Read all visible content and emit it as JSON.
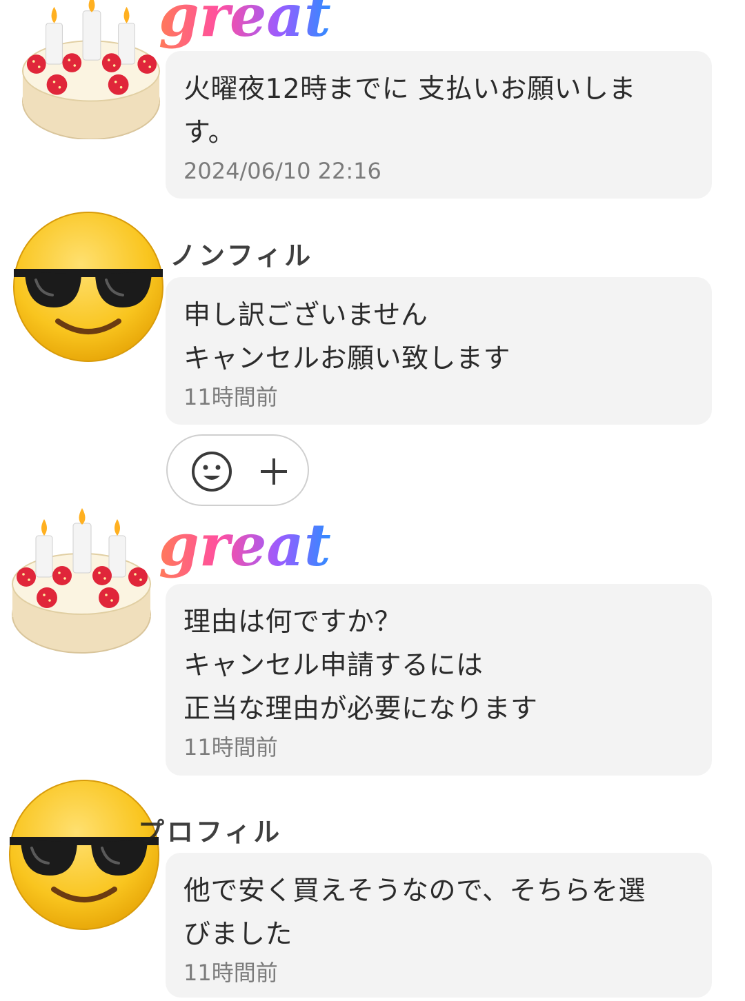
{
  "messages": [
    {
      "id": "m1",
      "sender_label": "",
      "text": "火曜夜12時までに 支払いお願いしま\nす。",
      "time": "2024/06/10 22:16"
    },
    {
      "id": "m2",
      "sender_label": "ノンフィル",
      "text": "申し訳ございません\nキャンセルお願い致します",
      "time": "11時間前"
    },
    {
      "id": "m3",
      "sender_label": "",
      "text": "理由は何ですか？\nキャンセル申請するには\n正当な理由が必要になります",
      "time": "11時間前"
    },
    {
      "id": "m4",
      "sender_label": "プロフィル",
      "text": "他で安く買えそうなので、そちらを選\nびました",
      "time": "11時間前"
    }
  ],
  "stickers": {
    "great_text": "great"
  },
  "icons": {
    "seller_avatar": "birthday-cake-icon",
    "buyer_avatar": "sunglasses-face-icon",
    "add_reaction": "smiley-icon",
    "add": "plus-icon"
  },
  "colors": {
    "bubble_bg": "#f3f3f3",
    "time_text": "#7b7b7b",
    "pill_border": "#cfcfcf"
  }
}
